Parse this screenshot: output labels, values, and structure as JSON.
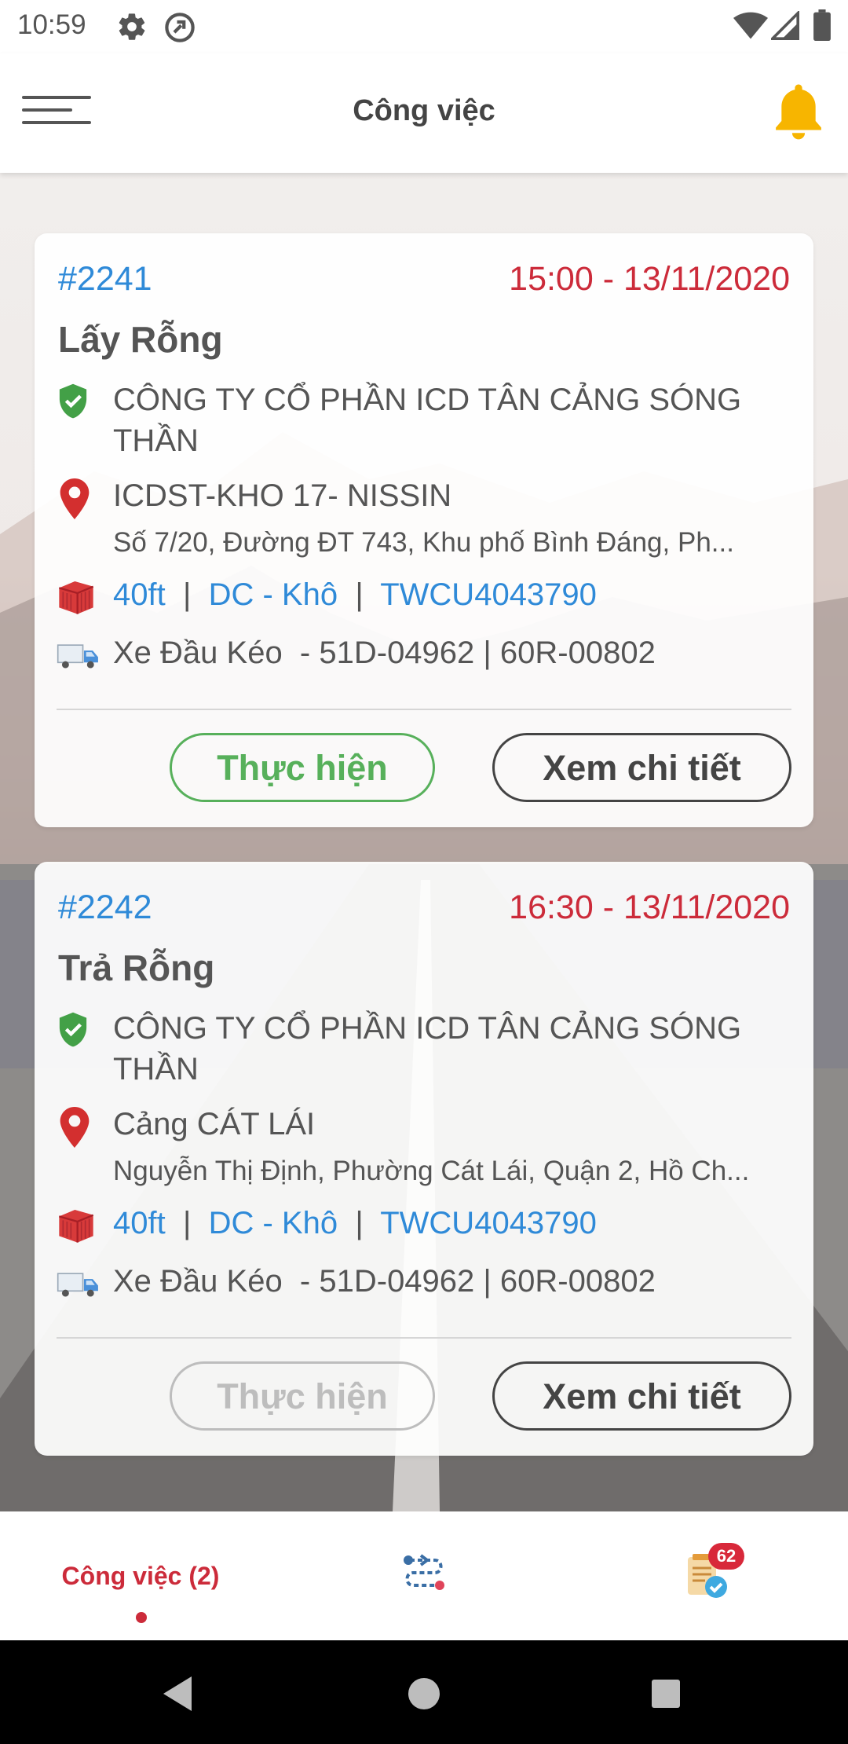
{
  "status_bar": {
    "time": "10:59",
    "icons": [
      "settings-gear-icon",
      "vpn-key-icon",
      "wifi-icon",
      "cell-signal-icon",
      "battery-icon"
    ]
  },
  "app_bar": {
    "title": "Công việc",
    "menu_icon": "hamburger-menu-icon",
    "notification_icon": "bell-icon",
    "bell_color": "#f7b500"
  },
  "jobs": [
    {
      "id": "#2241",
      "datetime": "15:00 - 13/11/2020",
      "title": "Lấy Rỗng",
      "company": "CÔNG TY CỔ PHẦN ICD TÂN CẢNG SÓNG THẦN",
      "location_name": "ICDST-KHO 17- NISSIN",
      "location_address": "Số 7/20, Đường ĐT 743, Khu phố Bình Đáng, Ph...",
      "container_size": "40ft",
      "container_sep1": " | ",
      "container_type": "DC - Khô",
      "container_sep2": " | ",
      "container_no": "TWCU4043790",
      "vehicle": "Xe Đầu Kéo  - 51D-04962 | 60R-00802",
      "do_label": "Thực hiện",
      "do_enabled": true,
      "detail_label": "Xem chi tiết"
    },
    {
      "id": "#2242",
      "datetime": "16:30 - 13/11/2020",
      "title": "Trả Rỗng",
      "company": "CÔNG TY CỔ PHẦN ICD TÂN CẢNG SÓNG THẦN",
      "location_name": "Cảng CÁT LÁI",
      "location_address": "Nguyễn Thị Định, Phường Cát Lái, Quận 2, Hồ Ch...",
      "container_size": "40ft",
      "container_sep1": " | ",
      "container_type": "DC - Khô",
      "container_sep2": " | ",
      "container_no": "TWCU4043790",
      "vehicle": "Xe Đầu Kéo  - 51D-04962 | 60R-00802",
      "do_label": "Thực hiện",
      "do_enabled": false,
      "detail_label": "Xem chi tiết"
    }
  ],
  "bottom_nav": {
    "tab_jobs_label": "Công việc (2)",
    "tab_route_icon": "route-icon",
    "tab_tasks_icon": "task-list-icon",
    "tasks_badge": "62",
    "active_color": "#cc2b3a"
  },
  "colors": {
    "link_blue": "#2f8ad8",
    "datetime_red": "#cc2b3a",
    "action_green": "#57b05b",
    "shield_green": "#43a047",
    "pin_red": "#d32f2f",
    "container_red": "#d83a3a"
  }
}
